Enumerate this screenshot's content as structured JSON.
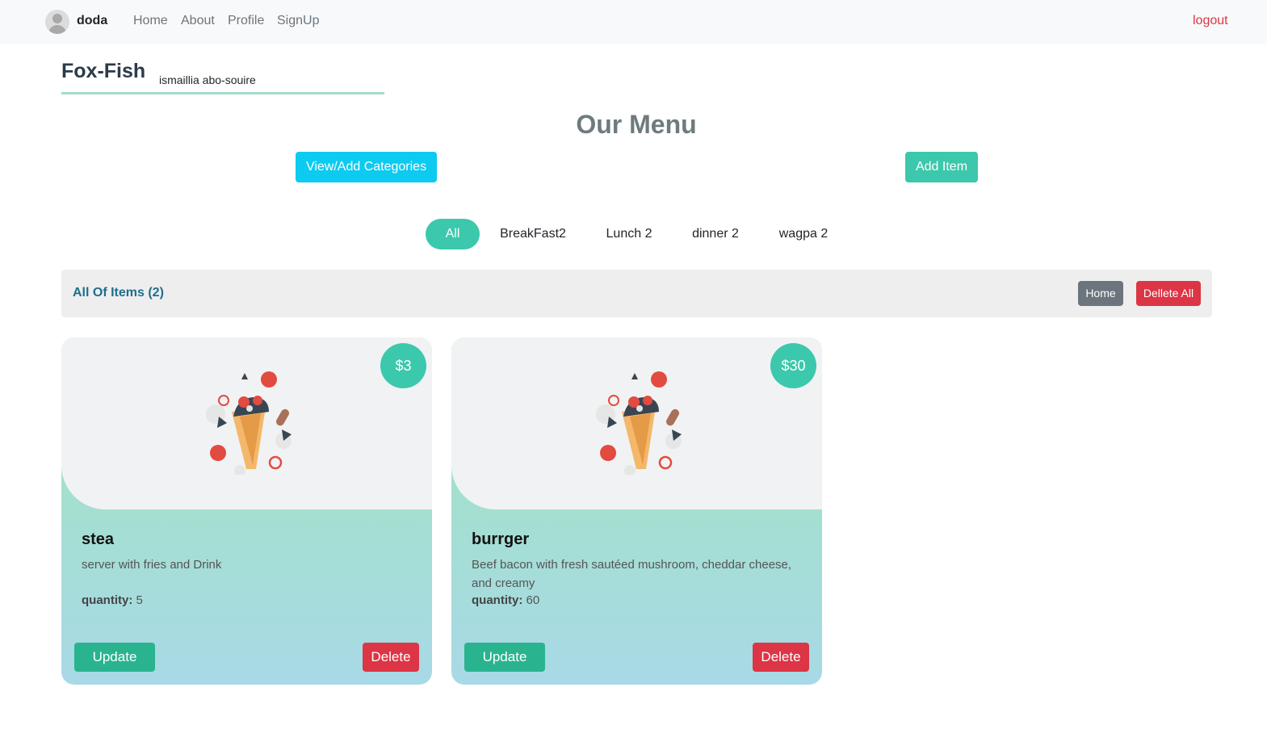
{
  "nav": {
    "user": "doda",
    "links": [
      "Home",
      "About",
      "Profile",
      "SignUp"
    ],
    "logout": "logout"
  },
  "restaurant": {
    "name": "Fox-Fish",
    "address": "ismaillia abo-souire"
  },
  "menu": {
    "title": "Our Menu",
    "view_categories_label": "View/Add Categories",
    "add_item_label": "Add Item",
    "categories": [
      "All",
      "BreakFast2",
      "Lunch 2",
      "dinner 2",
      "wagpa 2"
    ],
    "active_category": "All"
  },
  "items_bar": {
    "title": "All Of Items (2)",
    "home_label": "Home",
    "delete_all_label": "Dellete All"
  },
  "items": [
    {
      "price": "$3",
      "name": "stea",
      "description": "server with fries and Drink",
      "quantity_label": "quantity:",
      "quantity": "5",
      "update_label": "Update",
      "delete_label": "Delete"
    },
    {
      "price": "$30",
      "name": "burrger",
      "description": "Beef bacon with fresh sautéed mushroom, cheddar cheese, and creamy",
      "quantity_label": "quantity:",
      "quantity": "60",
      "update_label": "Update",
      "delete_label": "Delete"
    }
  ],
  "colors": {
    "accent": "#3cc8ac",
    "info": "#0dcaf0",
    "danger": "#dc3545",
    "secondary": "#6c757d"
  }
}
